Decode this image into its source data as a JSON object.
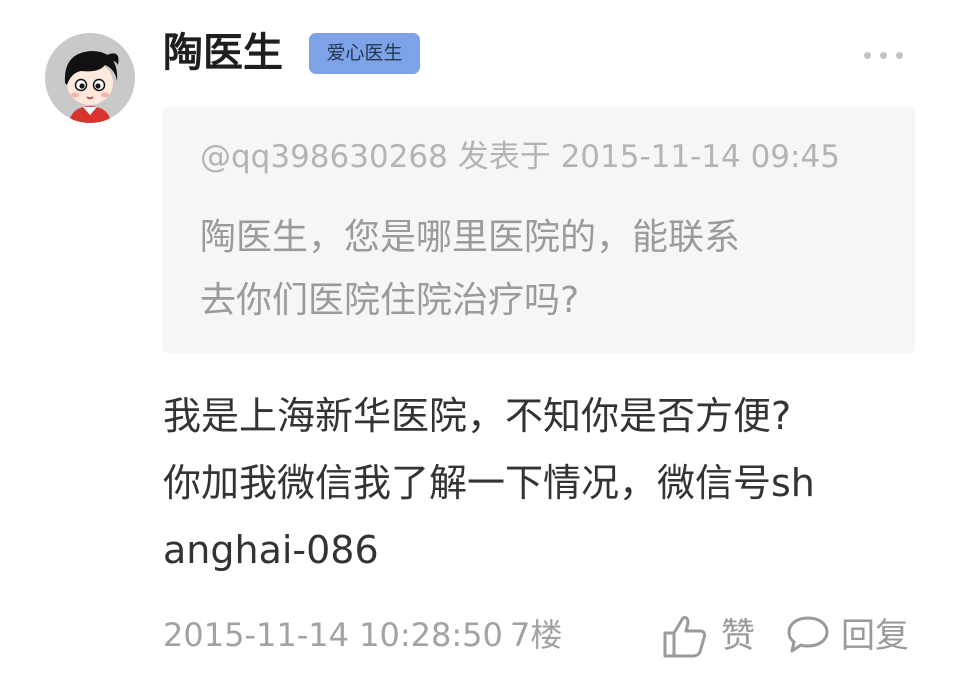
{
  "author": {
    "name": "陶医生",
    "badge": "爱心医生"
  },
  "quote": {
    "meta": "@qq398630268 发表于 2015-11-14 09:45",
    "text": "陶医生，您是哪里医院的，能联系\n去你们医院住院治疗吗?"
  },
  "reply": {
    "text": "我是上海新华医院，不知你是否方便?\n你加我微信我了解一下情况，微信号sh\nanghai-086"
  },
  "footer": {
    "time": "2015-11-14 10:28:50",
    "floor": "7楼",
    "like_label": "赞",
    "reply_label": "回复"
  },
  "icons": {
    "avatar": "cartoon-avatar",
    "more": "more-icon",
    "like": "thumbs-up-icon",
    "reply": "comment-bubble-icon"
  },
  "colors": {
    "badge_bg": "#7ea2e8",
    "quote_bg": "#f6f6f6",
    "meta_text": "#a2a2a2"
  }
}
